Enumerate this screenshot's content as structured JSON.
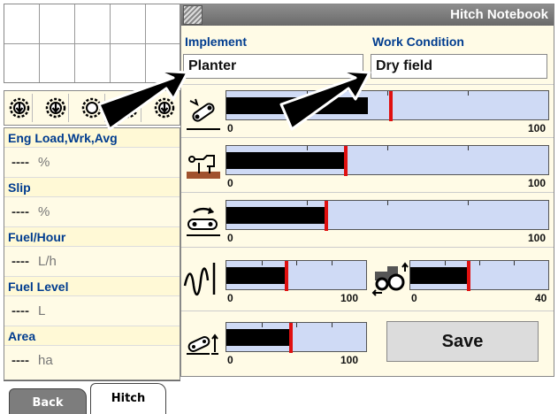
{
  "window": {
    "title": "Hitch Notebook"
  },
  "fields": {
    "implement_label": "Implement",
    "implement_value": "Planter",
    "work_condition_label": "Work Condition",
    "work_condition_value": "Dry field"
  },
  "readouts": [
    {
      "label": "Eng Load,Wrk,Avg",
      "value": "----",
      "unit": "%"
    },
    {
      "label": "Slip",
      "value": "----",
      "unit": "%"
    },
    {
      "label": "Fuel/Hour",
      "value": "----",
      "unit": "L/h"
    },
    {
      "label": "Fuel Level",
      "value": "----",
      "unit": "L"
    },
    {
      "label": "Area",
      "value": "----",
      "unit": "ha"
    }
  ],
  "gauges": {
    "draft_sensitivity": {
      "min": "0",
      "max": "100",
      "level": 0.44,
      "marker": 0.51
    },
    "depth_control": {
      "min": "0",
      "max": "100",
      "level": 0.37,
      "marker": 0.37
    },
    "raise_rate": {
      "min": "0",
      "max": "100",
      "level": 0.31,
      "marker": 0.31
    },
    "drop_rate": {
      "min": "0",
      "max": "100",
      "level": 0.43,
      "marker": 0.43
    },
    "slip_limit": {
      "min": "0",
      "max": "40",
      "level": 0.42,
      "marker": 0.42
    },
    "upper_limit": {
      "min": "0",
      "max": "100",
      "level": 0.46,
      "marker": 0.46
    }
  },
  "buttons": {
    "save": "Save"
  },
  "tabs": {
    "back": "Back",
    "hitch": "Hitch"
  },
  "colors": {
    "accent_text": "#003c8f",
    "marker": "#e01010",
    "bar_bg": "#cfdaf5",
    "panel_bg": "#fffbe6"
  }
}
